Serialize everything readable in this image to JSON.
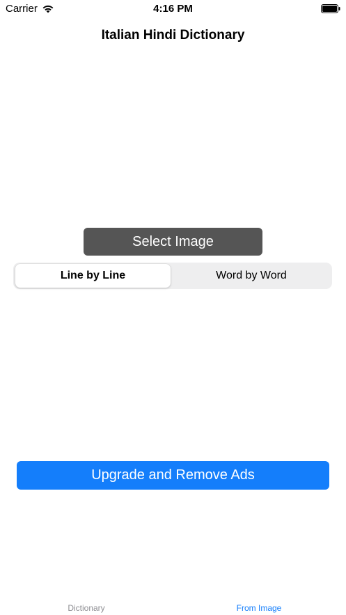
{
  "status_bar": {
    "carrier": "Carrier",
    "time": "4:16 PM"
  },
  "title": "Italian Hindi Dictionary",
  "select_image_label": "Select Image",
  "segmented_control": {
    "options": [
      "Line by Line",
      "Word by Word"
    ],
    "selected": "Line by Line"
  },
  "upgrade_label": "Upgrade and Remove Ads",
  "tab_bar": {
    "tabs": [
      {
        "label": "Dictionary",
        "active": false
      },
      {
        "label": "From Image",
        "active": true
      }
    ]
  },
  "colors": {
    "accent": "#147efb",
    "select_button": "#555555",
    "inactive_tab": "#8e8e93"
  }
}
